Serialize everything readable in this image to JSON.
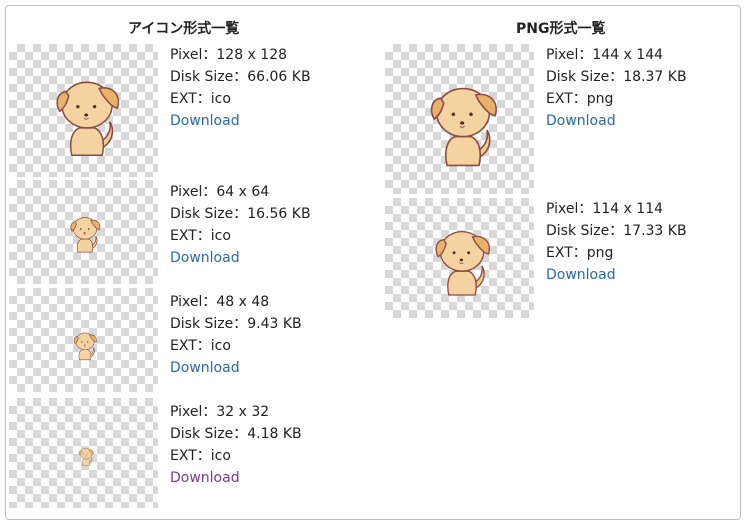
{
  "icon_section": {
    "title": "アイコン形式一覧",
    "items": [
      {
        "pixel": "Pixel：128 x 128",
        "disk": "Disk Size：66.06 KB",
        "ext": "EXT：ico",
        "download": "Download"
      },
      {
        "pixel": "Pixel：64 x 64",
        "disk": "Disk Size：16.56 KB",
        "ext": "EXT：ico",
        "download": "Download"
      },
      {
        "pixel": "Pixel：48 x 48",
        "disk": "Disk Size：9.43 KB",
        "ext": "EXT：ico",
        "download": "Download"
      },
      {
        "pixel": "Pixel：32 x 32",
        "disk": "Disk Size：4.18 KB",
        "ext": "EXT：ico",
        "download": "Download"
      }
    ]
  },
  "png_section": {
    "title": "PNG形式一覧",
    "items": [
      {
        "pixel": "Pixel：144 x 144",
        "disk": "Disk Size：18.37 KB",
        "ext": "EXT：png",
        "download": "Download"
      },
      {
        "pixel": "Pixel：114 x 114",
        "disk": "Disk Size：17.33 KB",
        "ext": "EXT：png",
        "download": "Download"
      }
    ]
  },
  "colors": {
    "link": "#2a6aa8",
    "visited_link": "#7a3c8a",
    "checker": "#d8d8d8"
  },
  "image_subject": "puppy-icon"
}
